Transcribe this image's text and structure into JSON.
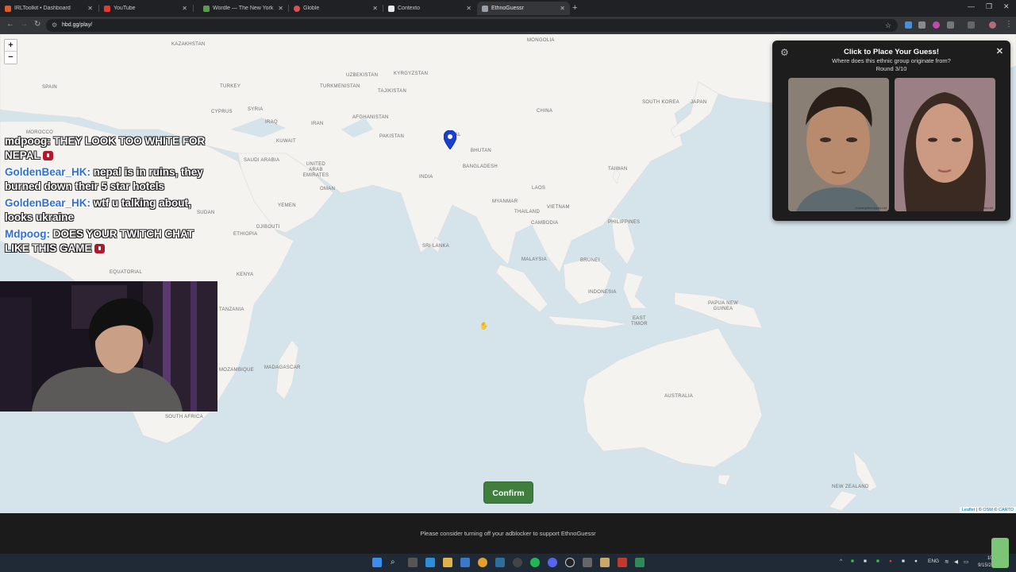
{
  "browser": {
    "tabs": [
      {
        "label": "IRLToolkit • Dashboard",
        "color": "#e05a2a"
      },
      {
        "label": "YouTube",
        "color": "#e53935"
      },
      {
        "label": "Wordle — The New York Times",
        "color": "#5a9b4f"
      },
      {
        "label": "Globle",
        "color": "#d9534f"
      },
      {
        "label": "Contexto",
        "color": "#e8eaed"
      },
      {
        "label": "EthnoGuessr",
        "color": "#9aa0a6"
      }
    ],
    "active_tab_index": 5,
    "url": "hbd.gg/play/"
  },
  "map": {
    "labels": {
      "mongolia": "MONGOLIA",
      "kazakhstan": "KAZAKHSTAN",
      "uzbekistan": "UZBEKISTAN",
      "kyrgyzstan": "KYRGYZSTAN",
      "turkmenistan": "TURKMENISTAN",
      "tajikistan": "TAJIKISTAN",
      "turkey": "TURKEY",
      "spain": "SPAIN",
      "cyprus": "CYPRUS",
      "syria": "SYRIA",
      "iraq": "IRAQ",
      "iran": "IRAN",
      "afghanistan": "AFGHANISTAN",
      "pakistan": "PAKISTAN",
      "kuwait": "KUWAIT",
      "nepal": "NEPAL",
      "bhutan": "BHUTAN",
      "china": "CHINA",
      "south_korea": "SOUTH KOREA",
      "japan": "JAPAN",
      "morocco": "MOROCCO",
      "saudi_arabia": "SAUDI ARABIA",
      "uae": "UNITED ARAB EMIRATES",
      "bangladesh": "BANGLADESH",
      "india": "INDIA",
      "taiwan": "TAIWAN",
      "oman": "OMAN",
      "yemen": "YEMEN",
      "sudan": "SUDAN",
      "laos": "LAOS",
      "myanmar": "MYANMAR",
      "thailand": "THAILAND",
      "vietnam": "VIETNAM",
      "ethiopia": "ETHIOPIA",
      "philippines": "PHILIPPINES",
      "cambodia": "CAMBODIA",
      "sri_lanka": "SRI LANKA",
      "malaysia": "MALAYSIA",
      "brunei": "BRUNEI",
      "kenya": "KENYA",
      "indonesia": "INDONESIA",
      "papua": "PAPUA NEW\nGUINEA",
      "tanzania": "TANZANIA",
      "east_timor": "EAST\nTIMOR",
      "mozambique": "MOZAMBIQUE",
      "madagascar": "MADAGASCAR",
      "australia": "AUSTRALIA",
      "south_africa": "SOUTH AFRICA",
      "new_zealand": "NEW ZEALAND",
      "equatorial": "EQUATORIAL",
      "djibouti": "DJIBOUTI"
    },
    "zoom_in": "+",
    "zoom_out": "−",
    "attribution": {
      "leaflet": "Leaflet",
      "sep": " | © ",
      "osm": "OSM",
      "mid": " © ",
      "carto": "CARTO"
    }
  },
  "chat": [
    {
      "user": "mdpoog:",
      "text": " THEY LOOK TOO WHITE FOR NEPAL",
      "emote": true,
      "user_style": "white"
    },
    {
      "user": "GoldenBear_HK:",
      "text": " nepal is in ruins, they burned down their 5 star hotels",
      "emote": false
    },
    {
      "user": "GoldenBear_HK:",
      "text": " wtf u talking about, looks ukraine",
      "emote": false
    },
    {
      "user": "Mdpoog:",
      "text": " DOES YOUR TWITCH CHAT LIKE THIS GAME",
      "emote": true
    }
  ],
  "panel": {
    "title": "Click to Place Your Guess!",
    "subtitle": "Where does this ethnic group originate from?",
    "round": "Round 3/10",
    "close": "✕",
    "face_caption_left": "humanphenotypes.net",
    "face_caption_right": "humanphenotypes.net"
  },
  "confirm_label": "Confirm",
  "footer_text": "Please consider turning off your adblocker to support EthnoGuessr",
  "taskbar": {
    "lang": "ENG",
    "time": "10:53",
    "date": "9/15/2025"
  }
}
